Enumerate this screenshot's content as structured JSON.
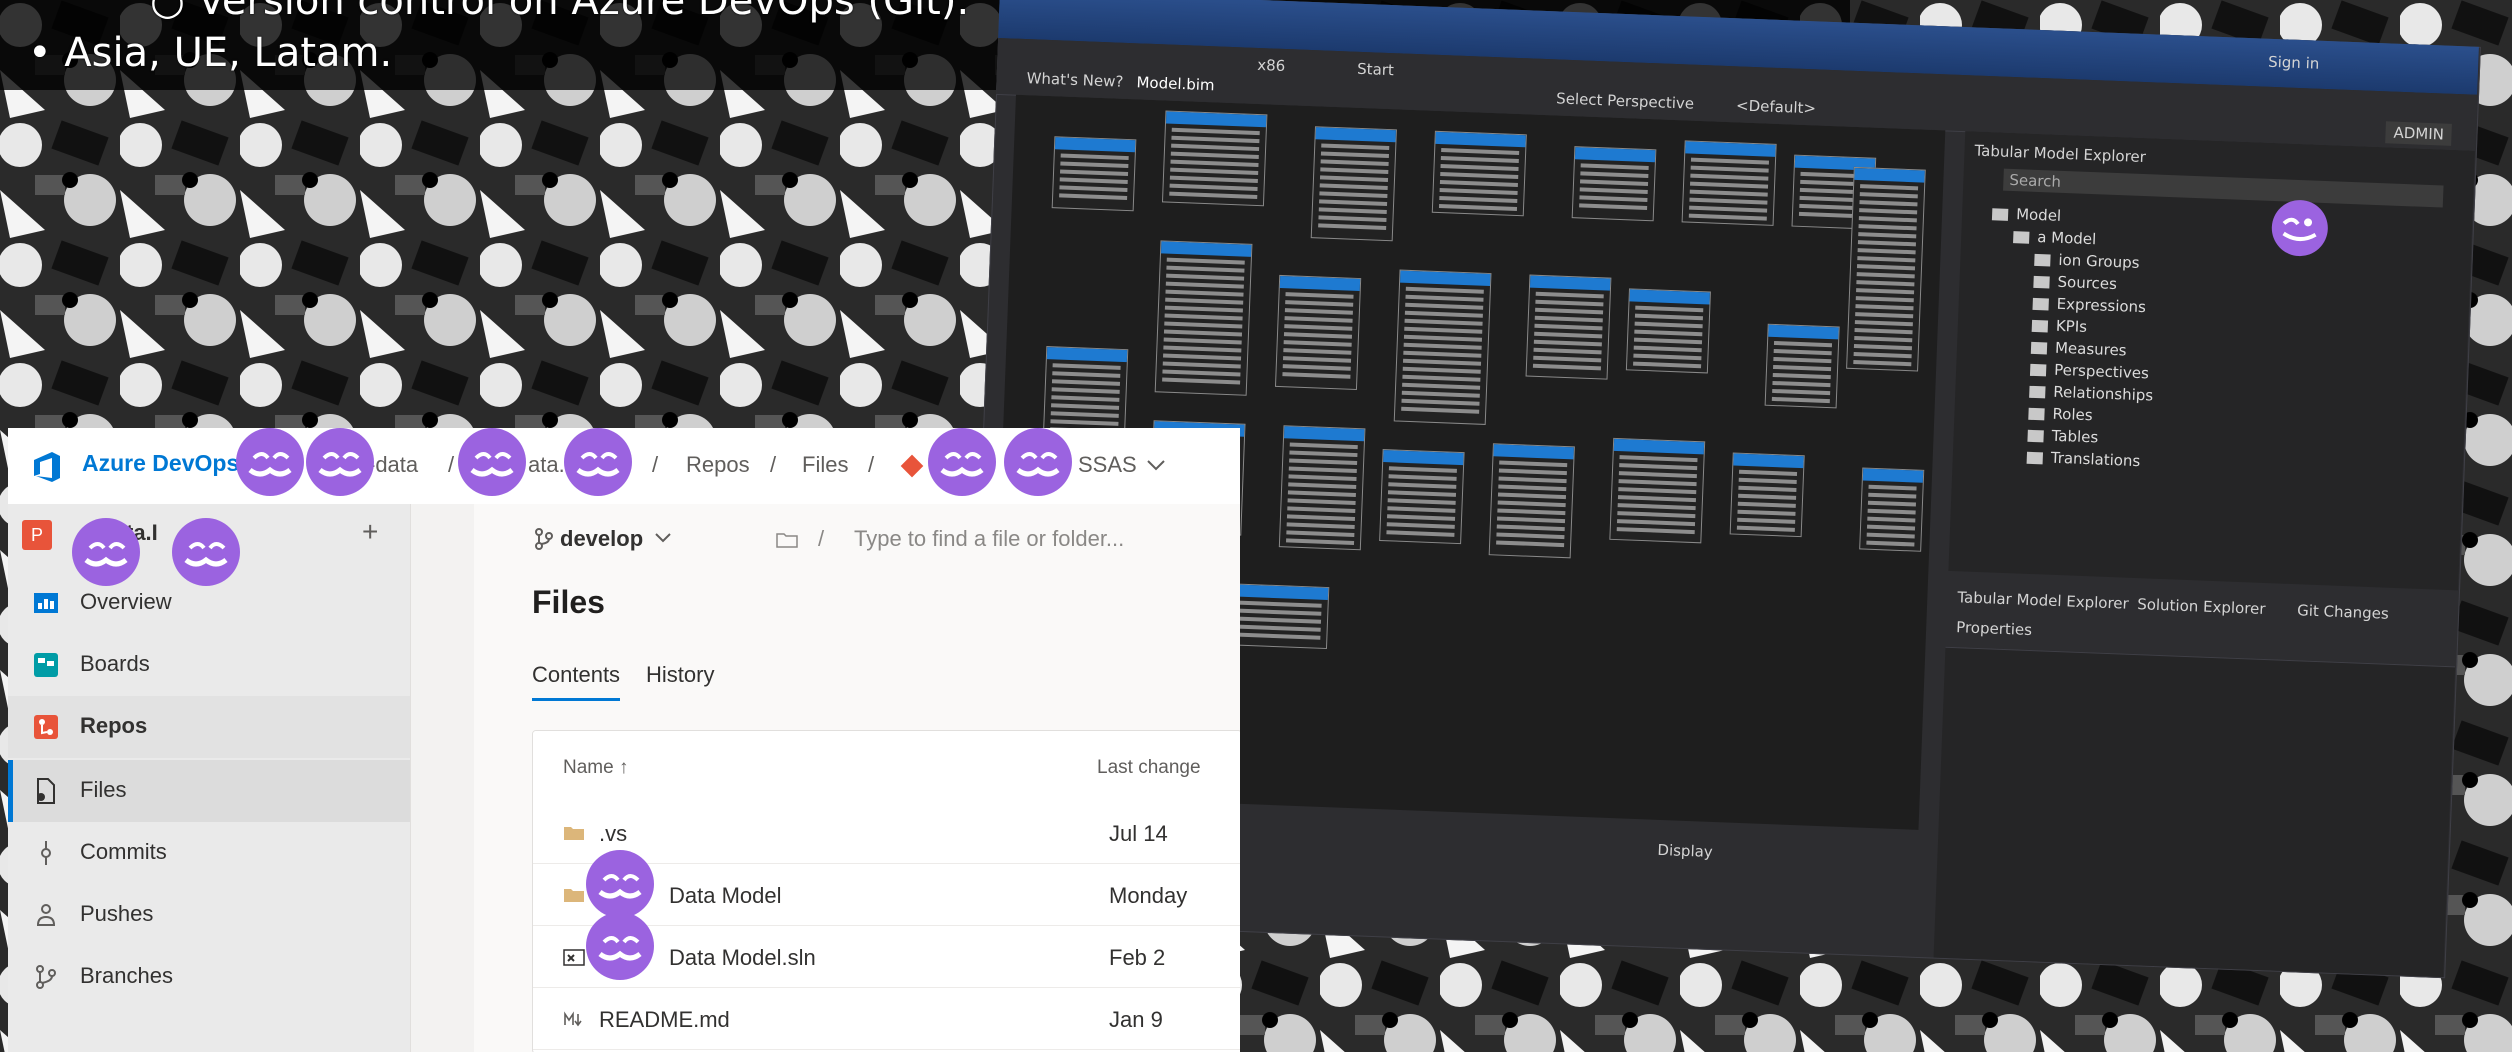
{
  "slide": {
    "line1": "○   Version control on Azure DevOps (Git).",
    "line2": "•    Asia, UE, Latam."
  },
  "ado": {
    "brand": "Azure DevOps",
    "breadcrumb": [
      "-data",
      "/",
      "ata.",
      "/",
      "Repos",
      "/",
      "Files",
      "/",
      "SSAS"
    ],
    "project_label": "ta.I",
    "project_initial": "P",
    "add_symbol": "+",
    "nav": [
      {
        "label": "Overview",
        "icon": "overview-icon"
      },
      {
        "label": "Boards",
        "icon": "boards-icon"
      },
      {
        "label": "Repos",
        "icon": "repos-icon"
      },
      {
        "label": "Files",
        "icon": "files-icon"
      },
      {
        "label": "Commits",
        "icon": "commits-icon"
      },
      {
        "label": "Pushes",
        "icon": "pushes-icon"
      },
      {
        "label": "Branches",
        "icon": "branches-icon"
      }
    ],
    "branch": "develop",
    "path_separator": "/",
    "search_placeholder": "Type to find a file or folder...",
    "page_title": "Files",
    "tabs": [
      "Contents",
      "History"
    ],
    "columns": {
      "name": "Name ↑",
      "last_change": "Last change"
    },
    "files": [
      {
        "name": ".vs",
        "date": "Jul 14",
        "icon": "folder-icon"
      },
      {
        "name": "Data Model",
        "date": "Monday",
        "icon": "folder-icon"
      },
      {
        "name": "Data Model.sln",
        "date": "Feb 2",
        "icon": "solution-file-icon"
      },
      {
        "name": "README.md",
        "date": "Jan 9",
        "icon": "markdown-file-icon"
      }
    ]
  },
  "vs": {
    "tabs": [
      "What's New?",
      "Model.bim"
    ],
    "toolbar": {
      "config": "x86",
      "start": "Start",
      "perspective_label": "Select Perspective",
      "perspective_value": "<Default>"
    },
    "sign_in": "Sign in",
    "admin": "ADMIN",
    "explorer_title": "Tabular Model Explorer",
    "search_placeholder": "Search",
    "tree": [
      {
        "label": "Model",
        "level": 0
      },
      {
        "label": "a Model",
        "level": 1
      },
      {
        "label": "ion Groups",
        "level": 2
      },
      {
        "label": "Sources",
        "level": 2
      },
      {
        "label": "Expressions",
        "level": 2
      },
      {
        "label": "KPIs",
        "level": 2
      },
      {
        "label": "Measures",
        "level": 2
      },
      {
        "label": "Perspectives",
        "level": 2
      },
      {
        "label": "Relationships",
        "level": 2
      },
      {
        "label": "Roles",
        "level": 2
      },
      {
        "label": "Tables",
        "level": 2
      },
      {
        "label": "Translations",
        "level": 2
      }
    ],
    "bottom_tabs": [
      "Tabular Model Explorer",
      "Solution Explorer",
      "Git Changes"
    ],
    "properties_title": "Properties",
    "display_label": "Display"
  },
  "colors": {
    "accent": "#0078d4",
    "avatar": "#9b63e0",
    "vs_blue": "#1e7ad1"
  }
}
